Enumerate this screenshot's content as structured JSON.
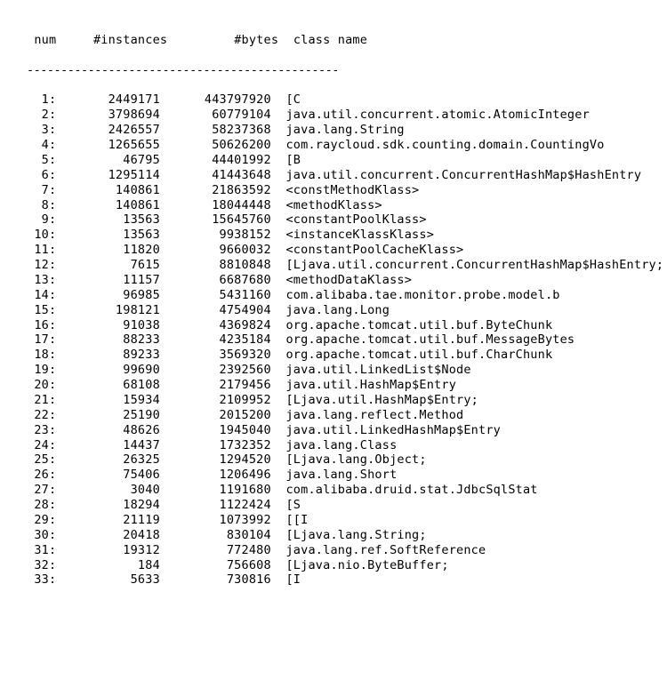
{
  "header": {
    "num": " num",
    "instances": "#instances",
    "bytes": "#bytes",
    "className": "class name",
    "rule": "----------------------------------------------"
  },
  "columns": {
    "numWidth": 4,
    "instWidth": 14,
    "bytesWidth": 15,
    "gap": "  "
  },
  "rows": [
    {
      "num": "1:",
      "instances": "2449171",
      "bytes": "443797920",
      "className": "[C"
    },
    {
      "num": "2:",
      "instances": "3798694",
      "bytes": "60779104",
      "className": "java.util.concurrent.atomic.AtomicInteger"
    },
    {
      "num": "3:",
      "instances": "2426557",
      "bytes": "58237368",
      "className": "java.lang.String"
    },
    {
      "num": "4:",
      "instances": "1265655",
      "bytes": "50626200",
      "className": "com.raycloud.sdk.counting.domain.CountingVo"
    },
    {
      "num": "5:",
      "instances": "46795",
      "bytes": "44401992",
      "className": "[B"
    },
    {
      "num": "6:",
      "instances": "1295114",
      "bytes": "41443648",
      "className": "java.util.concurrent.ConcurrentHashMap$HashEntry"
    },
    {
      "num": "7:",
      "instances": "140861",
      "bytes": "21863592",
      "className": "<constMethodKlass>"
    },
    {
      "num": "8:",
      "instances": "140861",
      "bytes": "18044448",
      "className": "<methodKlass>"
    },
    {
      "num": "9:",
      "instances": "13563",
      "bytes": "15645760",
      "className": "<constantPoolKlass>"
    },
    {
      "num": "10:",
      "instances": "13563",
      "bytes": "9938152",
      "className": "<instanceKlassKlass>"
    },
    {
      "num": "11:",
      "instances": "11820",
      "bytes": "9660032",
      "className": "<constantPoolCacheKlass>"
    },
    {
      "num": "12:",
      "instances": "7615",
      "bytes": "8810848",
      "className": "[Ljava.util.concurrent.ConcurrentHashMap$HashEntry;"
    },
    {
      "num": "13:",
      "instances": "11157",
      "bytes": "6687680",
      "className": "<methodDataKlass>"
    },
    {
      "num": "14:",
      "instances": "96985",
      "bytes": "5431160",
      "className": "com.alibaba.tae.monitor.probe.model.b"
    },
    {
      "num": "15:",
      "instances": "198121",
      "bytes": "4754904",
      "className": "java.lang.Long"
    },
    {
      "num": "16:",
      "instances": "91038",
      "bytes": "4369824",
      "className": "org.apache.tomcat.util.buf.ByteChunk"
    },
    {
      "num": "17:",
      "instances": "88233",
      "bytes": "4235184",
      "className": "org.apache.tomcat.util.buf.MessageBytes"
    },
    {
      "num": "18:",
      "instances": "89233",
      "bytes": "3569320",
      "className": "org.apache.tomcat.util.buf.CharChunk"
    },
    {
      "num": "19:",
      "instances": "99690",
      "bytes": "2392560",
      "className": "java.util.LinkedList$Node"
    },
    {
      "num": "20:",
      "instances": "68108",
      "bytes": "2179456",
      "className": "java.util.HashMap$Entry"
    },
    {
      "num": "21:",
      "instances": "15934",
      "bytes": "2109952",
      "className": "[Ljava.util.HashMap$Entry;"
    },
    {
      "num": "22:",
      "instances": "25190",
      "bytes": "2015200",
      "className": "java.lang.reflect.Method"
    },
    {
      "num": "23:",
      "instances": "48626",
      "bytes": "1945040",
      "className": "java.util.LinkedHashMap$Entry"
    },
    {
      "num": "24:",
      "instances": "14437",
      "bytes": "1732352",
      "className": "java.lang.Class"
    },
    {
      "num": "25:",
      "instances": "26325",
      "bytes": "1294520",
      "className": "[Ljava.lang.Object;"
    },
    {
      "num": "26:",
      "instances": "75406",
      "bytes": "1206496",
      "className": "java.lang.Short"
    },
    {
      "num": "27:",
      "instances": "3040",
      "bytes": "1191680",
      "className": "com.alibaba.druid.stat.JdbcSqlStat"
    },
    {
      "num": "28:",
      "instances": "18294",
      "bytes": "1122424",
      "className": "[S"
    },
    {
      "num": "29:",
      "instances": "21119",
      "bytes": "1073992",
      "className": "[[I"
    },
    {
      "num": "30:",
      "instances": "20418",
      "bytes": "830104",
      "className": "[Ljava.lang.String;"
    },
    {
      "num": "31:",
      "instances": "19312",
      "bytes": "772480",
      "className": "java.lang.ref.SoftReference"
    },
    {
      "num": "32:",
      "instances": "184",
      "bytes": "756608",
      "className": "[Ljava.nio.ByteBuffer;"
    },
    {
      "num": "33:",
      "instances": "5633",
      "bytes": "730816",
      "className": "[I"
    }
  ]
}
